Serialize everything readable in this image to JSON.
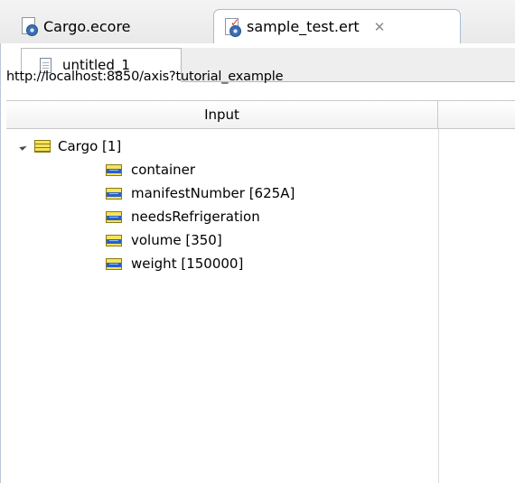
{
  "editor_tabs": [
    {
      "label": "Cargo.ecore",
      "active": false
    },
    {
      "label": "sample_test.ert",
      "active": true,
      "close": "✕"
    }
  ],
  "inner_tab": {
    "label": "untitled_1"
  },
  "url": "http://localhost:8850/axis?tutorial_example",
  "grid": {
    "column_input": "Input",
    "column_output": ""
  },
  "tree": {
    "root": {
      "label": "Cargo [1]",
      "expanded": true
    },
    "children": [
      {
        "label": "container"
      },
      {
        "label": "manifestNumber [625A]"
      },
      {
        "label": "needsRefrigeration"
      },
      {
        "label": "volume [350]"
      },
      {
        "label": "weight [150000]"
      }
    ]
  },
  "colors": {
    "tab_border": "#a7bdd3",
    "class_icon": "#f3e45a",
    "attr_icon_band": "#2a5fc8"
  }
}
